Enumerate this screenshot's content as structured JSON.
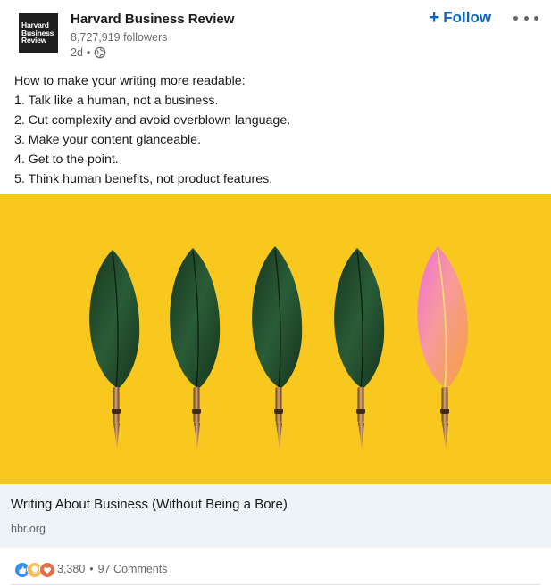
{
  "post": {
    "author": {
      "name": "Harvard Business Review",
      "logo_lines": [
        "Harvard",
        "Business",
        "Review"
      ],
      "followers": "8,727,919 followers",
      "time": "2d",
      "visibility_icon": "globe-icon"
    },
    "follow_label": "Follow",
    "follow_icon": "plus-icon",
    "more_icon": "more-horizontal-icon",
    "commentary": [
      "How to make your writing more readable:",
      "1. Talk like a human, not a business.",
      "2. Cut complexity and avoid overblown language.",
      "3. Make your content glanceable.",
      "4. Get to the point.",
      "5. Think human benefits, not product features."
    ],
    "image": {
      "background_color": "#f9c81f",
      "quill_colors": [
        "#1d4a2b",
        "#1d4a2b",
        "#1d4a2b",
        "#1d4a2b",
        "gradient-orange-pink"
      ]
    },
    "article": {
      "title": "Writing About Business (Without Being a Bore)",
      "source": "hbr.org"
    },
    "social": {
      "reaction_icons": [
        "like-icon",
        "insightful-icon",
        "love-icon"
      ],
      "reactions_count": "3,380",
      "separator": "•",
      "comments": "97 Comments"
    }
  },
  "colors": {
    "accent": "#0a66c2",
    "like": "#378fe9",
    "insightful": "#f5bb5c",
    "love": "#df704d",
    "article_bg": "#eef3f8"
  }
}
